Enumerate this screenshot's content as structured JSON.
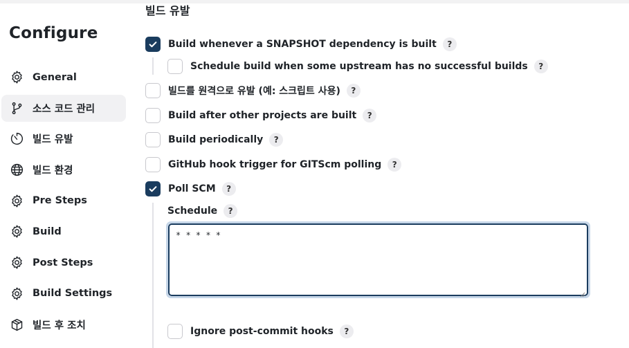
{
  "sidebar": {
    "title": "Configure",
    "items": [
      {
        "label": "General",
        "icon": "gear-icon",
        "active": false
      },
      {
        "label": "소스 코드 관리",
        "icon": "branch-icon",
        "active": true
      },
      {
        "label": "빌드 유발",
        "icon": "timer-icon",
        "active": false
      },
      {
        "label": "빌드 환경",
        "icon": "globe-icon",
        "active": false
      },
      {
        "label": "Pre Steps",
        "icon": "gear-icon",
        "active": false
      },
      {
        "label": "Build",
        "icon": "gear-icon",
        "active": false
      },
      {
        "label": "Post Steps",
        "icon": "gear-icon",
        "active": false
      },
      {
        "label": "Build Settings",
        "icon": "gear-icon",
        "active": false
      },
      {
        "label": "빌드 후 조치",
        "icon": "package-icon",
        "active": false
      }
    ]
  },
  "main": {
    "section_title": "빌드 유발",
    "help_symbol": "?",
    "options": {
      "snapshot": {
        "label": "Build whenever a SNAPSHOT dependency is built",
        "checked": true
      },
      "upstream": {
        "label": "Schedule build when some upstream has no successful builds",
        "checked": false
      },
      "remote": {
        "label": "빌드를 원격으로 유발 (예: 스크립트 사용)",
        "checked": false
      },
      "after_other": {
        "label": "Build after other projects are built",
        "checked": false
      },
      "periodically": {
        "label": "Build periodically",
        "checked": false
      },
      "github_hook": {
        "label": "GitHub hook trigger for GITScm polling",
        "checked": false
      },
      "poll_scm": {
        "label": "Poll SCM",
        "checked": true
      },
      "ignore_post_commit": {
        "label": "Ignore post-commit hooks",
        "checked": false
      }
    },
    "schedule": {
      "label": "Schedule",
      "value": "* * * * *"
    }
  },
  "colors": {
    "accent": "#1a3c5e",
    "focus_ring": "#c6d6e8",
    "active_nav_bg": "#f1f1f3"
  }
}
